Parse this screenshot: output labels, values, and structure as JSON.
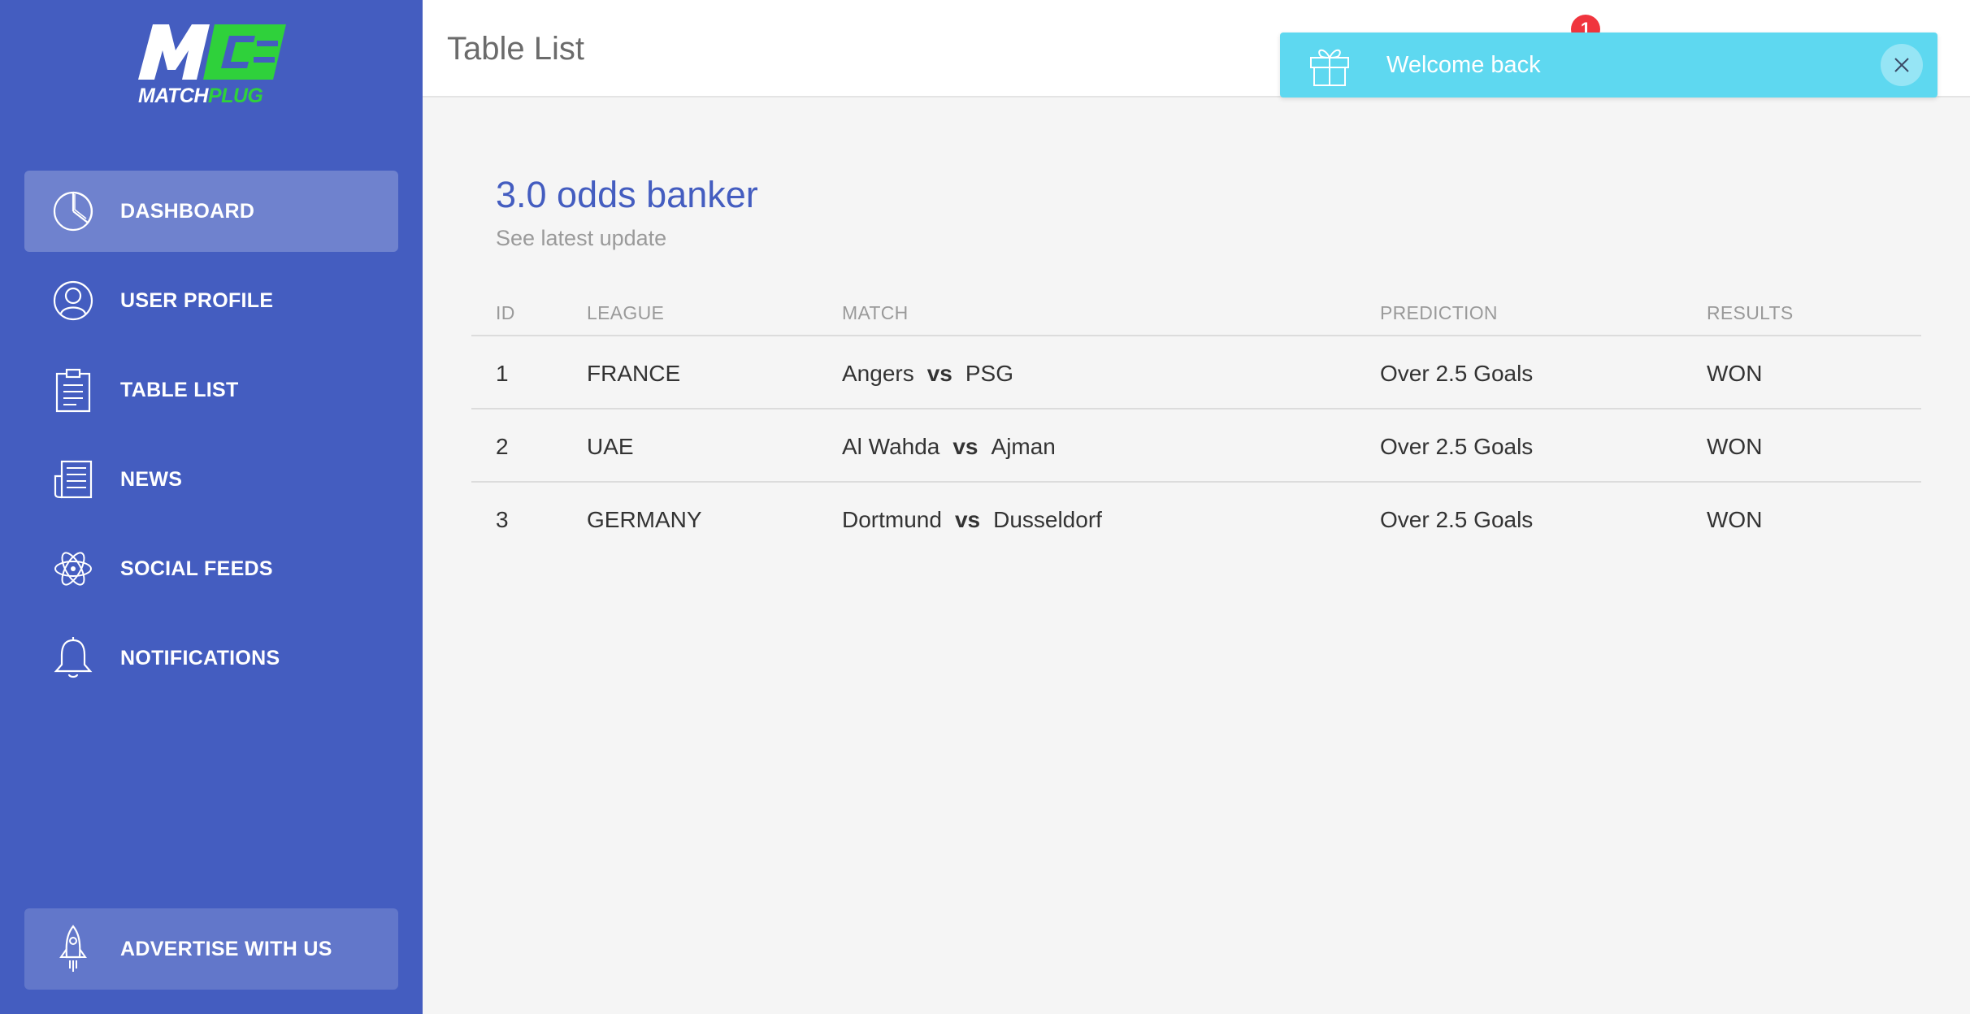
{
  "brand": {
    "mark": "M",
    "name_part1": "MATCH",
    "name_part2": "PLUG",
    "accent": "#2fd13b",
    "sidebar_color": "#445dc0"
  },
  "sidebar": {
    "items": [
      {
        "label": "Dashboard",
        "icon": "pie-chart-icon",
        "active": true
      },
      {
        "label": "User Profile",
        "icon": "user-icon",
        "active": false
      },
      {
        "label": "Table List",
        "icon": "clipboard-icon",
        "active": false
      },
      {
        "label": "News",
        "icon": "newspaper-icon",
        "active": false
      },
      {
        "label": "Social Feeds",
        "icon": "atom-icon",
        "active": false
      },
      {
        "label": "Notifications",
        "icon": "bell-icon",
        "active": false
      }
    ],
    "advertise": {
      "label": "ADVERTISE WITH US",
      "icon": "rocket-icon"
    }
  },
  "header": {
    "title": "Table List",
    "notification_count": "1"
  },
  "toast": {
    "message": "Welcome back",
    "icon": "gift-icon",
    "color": "#5ed8f0"
  },
  "card": {
    "title": "3.0 odds banker",
    "subtitle": "See latest update",
    "columns": [
      "ID",
      "LEAGUE",
      "MATCH",
      "PREDICTION",
      "RESULTS"
    ],
    "rows": [
      {
        "id": "1",
        "league": "FRANCE",
        "home": "Angers",
        "vs": "vs",
        "away": "PSG",
        "prediction": "Over 2.5 Goals",
        "result": "WON"
      },
      {
        "id": "2",
        "league": "UAE",
        "home": "Al Wahda",
        "vs": "vs",
        "away": "Ajman",
        "prediction": "Over 2.5 Goals",
        "result": "WON"
      },
      {
        "id": "3",
        "league": "GERMANY",
        "home": "Dortmund",
        "vs": "vs",
        "away": "Dusseldorf",
        "prediction": "Over 2.5 Goals",
        "result": "WON"
      }
    ]
  }
}
